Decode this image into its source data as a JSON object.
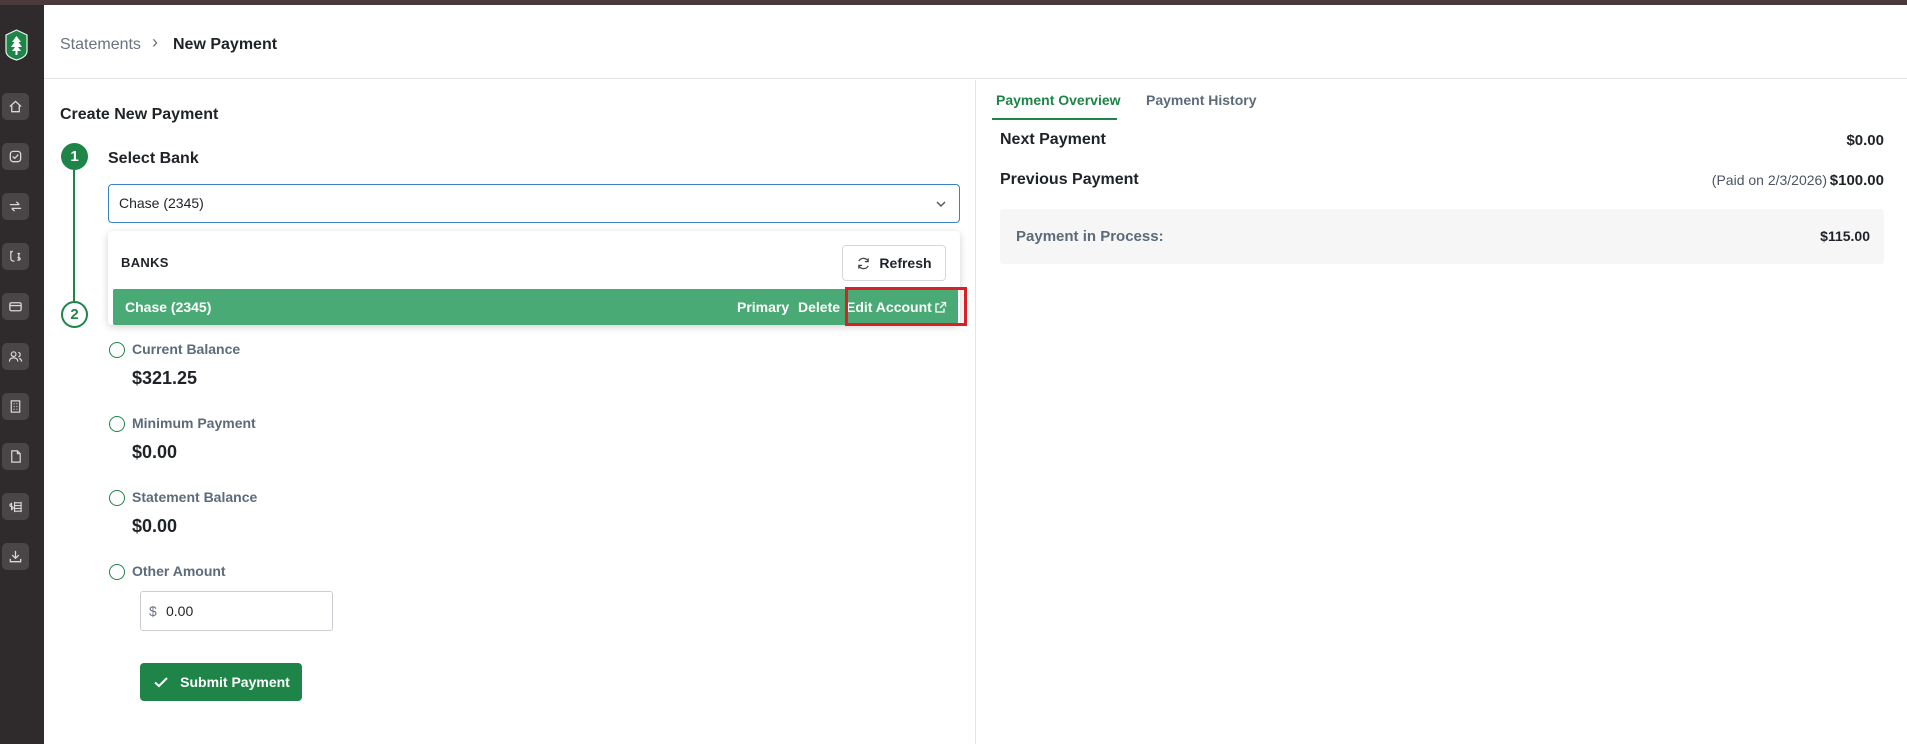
{
  "breadcrumb": {
    "parent": "Statements",
    "separator": "›",
    "current": "New Payment"
  },
  "form": {
    "title": "Create New Payment",
    "step1": {
      "number": "1",
      "label": "Select Bank"
    },
    "step2": {
      "number": "2"
    },
    "bank_select": {
      "value": "Chase (2345)"
    },
    "dropdown": {
      "heading": "BANKS",
      "refresh_label": "Refresh",
      "bank": {
        "name": "Chase (2345)",
        "primary_label": "Primary",
        "delete_label": "Delete",
        "edit_label": "Edit Account"
      }
    },
    "options": [
      {
        "label": "Current Balance",
        "value": "$321.25"
      },
      {
        "label": "Minimum Payment",
        "value": "$0.00"
      },
      {
        "label": "Statement Balance",
        "value": "$0.00"
      },
      {
        "label": "Other Amount"
      }
    ],
    "other_amount": {
      "currency": "$",
      "value": "0.00"
    },
    "submit_label": "Submit Payment"
  },
  "overview": {
    "tabs": [
      {
        "label": "Payment Overview",
        "active": true
      },
      {
        "label": "Payment History",
        "active": false
      }
    ],
    "next_payment": {
      "label": "Next Payment",
      "value": "$0.00"
    },
    "previous_payment": {
      "label": "Previous Payment",
      "note": "(Paid on 2/3/2026)",
      "value": "$100.00"
    },
    "in_process": {
      "label": "Payment in Process:",
      "value": "$115.00"
    }
  },
  "sidebar": {
    "icons": [
      "home-icon",
      "check-circle-icon",
      "transfer-icon",
      "payments-icon",
      "card-icon",
      "users-icon",
      "building-icon",
      "document-icon",
      "money-stack-icon",
      "download-icon"
    ]
  },
  "colors": {
    "accent": "#1e8448",
    "bank_row": "#4aaa75",
    "highlight": "#dc1f26",
    "sidebar": "#2f2a2b"
  }
}
